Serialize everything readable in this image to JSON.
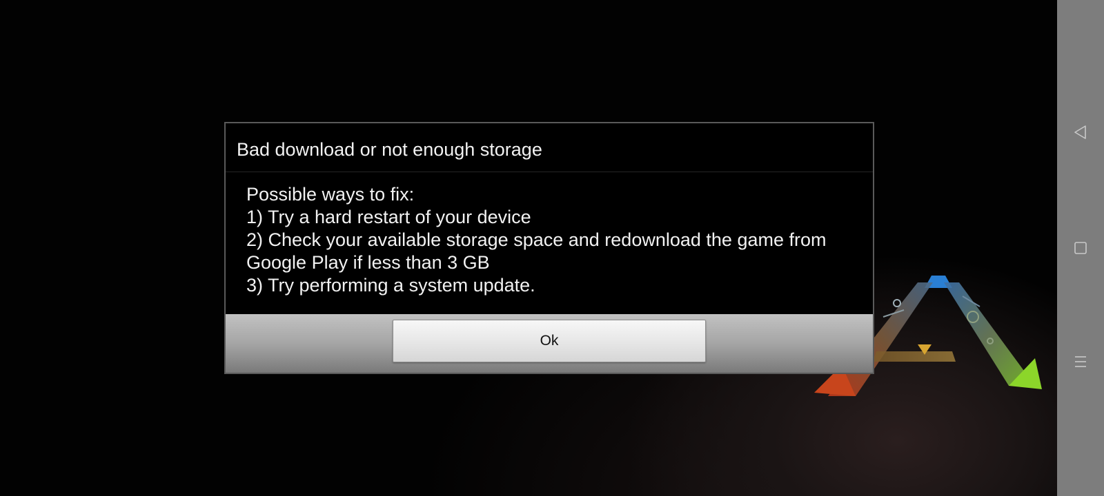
{
  "dialog": {
    "title": "Bad download or not enough storage",
    "body_lines": [
      "Possible ways to fix:",
      "1) Try a hard restart of your device",
      "2) Check your available storage space and redownload the game from",
      "Google Play if less than 3 GB",
      "3) Try performing a system update."
    ],
    "ok_label": "Ok"
  },
  "navbar": {
    "icons": [
      "back-icon",
      "home-icon",
      "menu-icon"
    ]
  },
  "colors": {
    "background": "#020202",
    "dialog_bg": "#000000",
    "dialog_text": "#f2f2f2",
    "navbar_bg": "#7d7d7d",
    "button_face": "#e6e6e6"
  }
}
